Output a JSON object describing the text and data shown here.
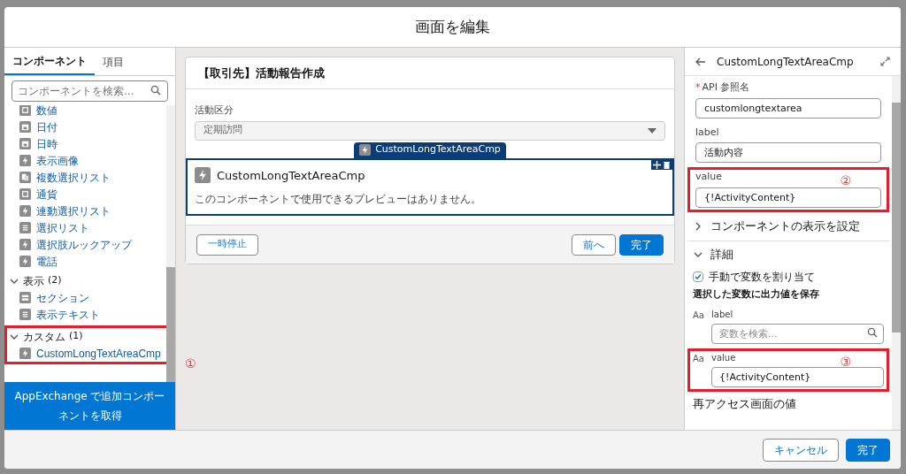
{
  "window": {
    "title": "画面を編集"
  },
  "left_panel": {
    "tabs": [
      {
        "label": "コンポーネント",
        "selected": true
      },
      {
        "label": "項目",
        "selected": false
      }
    ],
    "search": {
      "placeholder": "コンポーネントを検索..."
    },
    "items": [
      {
        "kind": "field",
        "label": "数値"
      },
      {
        "kind": "date",
        "label": "日付"
      },
      {
        "kind": "date",
        "label": "日時"
      },
      {
        "kind": "bolt",
        "label": "表示画像"
      },
      {
        "kind": "multi",
        "label": "複数選択リスト"
      },
      {
        "kind": "field",
        "label": "通貨"
      },
      {
        "kind": "bolt",
        "label": "連動選択リスト"
      },
      {
        "kind": "list",
        "label": "選択リスト"
      },
      {
        "kind": "bolt",
        "label": "選択肢ルックアップ"
      },
      {
        "kind": "bolt",
        "label": "電話"
      }
    ],
    "groups": [
      {
        "label": "表示",
        "count": "(2)",
        "expanded": true,
        "highlighted": false,
        "items": [
          {
            "kind": "section",
            "label": "セクション"
          },
          {
            "kind": "list",
            "label": "表示テキスト"
          }
        ]
      },
      {
        "label": "カスタム",
        "count": "(1)",
        "expanded": true,
        "highlighted": true,
        "items": [
          {
            "kind": "bolt",
            "label": "CustomLongTextAreaCmp"
          }
        ]
      }
    ],
    "appexchange_button": "AppExchange で追加コンポーネントを取得"
  },
  "canvas": {
    "marker": "①",
    "card": {
      "title": "【取引先】活動報告作成",
      "field": {
        "label": "活動区分",
        "value": "定期訪問"
      },
      "component": {
        "tag": "CustomLongTextAreaCmp",
        "title": "CustomLongTextAreaCmp",
        "message": "このコンポーネントで使用できるプレビューはありません。",
        "selected": true
      },
      "buttons": [
        {
          "label": "一時停止",
          "primary": false
        },
        {
          "label": "前へ",
          "primary": false
        },
        {
          "label": "完了",
          "primary": true
        }
      ]
    }
  },
  "right_panel": {
    "title": "CustomLongTextAreaCmp",
    "fields": [
      {
        "required_mark": "*",
        "label": "API 参照名",
        "value": "customlongtextarea",
        "highlighted": false
      },
      {
        "label": "label",
        "value": "活動内容",
        "highlighted": false
      },
      {
        "label": "value",
        "value": "{!ActivityContent}",
        "highlighted": true,
        "marker": "②"
      }
    ],
    "sections": [
      {
        "label": "コンポーネントの表示を設定",
        "expanded": false
      },
      {
        "label": "詳細",
        "expanded": true
      }
    ],
    "manual_assign": {
      "label": "手動で変数を割り当て",
      "checked": true
    },
    "outputs_heading": "選択した変数に出力値を保存",
    "outputs": [
      {
        "type_icon": "Aa",
        "label": "label",
        "placeholder": "変数を検索...",
        "highlighted": false
      },
      {
        "type_icon": "Aa",
        "label": "value",
        "value": "{!ActivityContent}",
        "highlighted": true,
        "marker": "③"
      }
    ],
    "next_section": "再アクセス画面の値"
  },
  "footer": {
    "buttons": [
      {
        "label": "キャンセル",
        "primary": false
      },
      {
        "label": "完了",
        "primary": true
      }
    ]
  }
}
